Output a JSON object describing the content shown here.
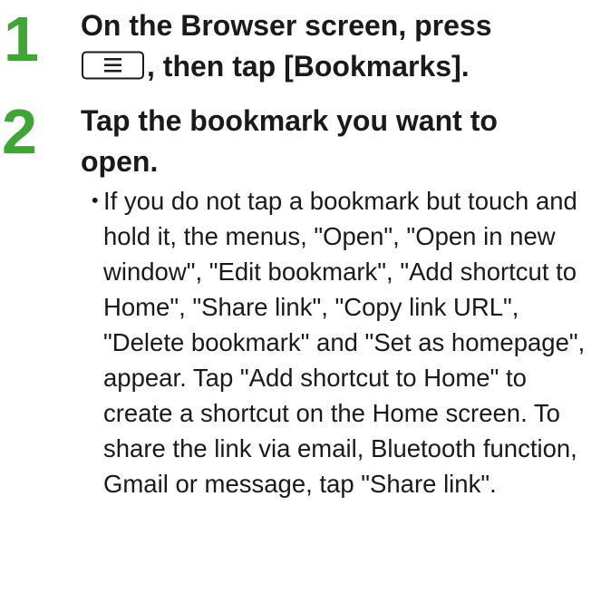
{
  "steps": [
    {
      "number": "1",
      "line1": "On the Browser screen, press",
      "line2_after_key": ", then tap [Bookmarks].",
      "key_icon": "menu-key-icon"
    },
    {
      "number": "2",
      "title": "Tap the bookmark you want to open.",
      "note_bullet": "・",
      "note": "If you do not tap a bookmark but touch and hold it, the menus, \"Open\", \"Open in new window\", \"Edit bookmark\", \"Add shortcut to Home\", \"Share link\", \"Copy link URL\", \"Delete bookmark\" and \"Set as homepage\", appear. Tap \"Add shortcut to Home\" to create a shortcut on the Home screen. To share the link via email, Bluetooth function, Gmail or message, tap \"Share link\"."
    }
  ],
  "colors": {
    "step_number": "#3fa535",
    "text": "#1a1a1a"
  }
}
